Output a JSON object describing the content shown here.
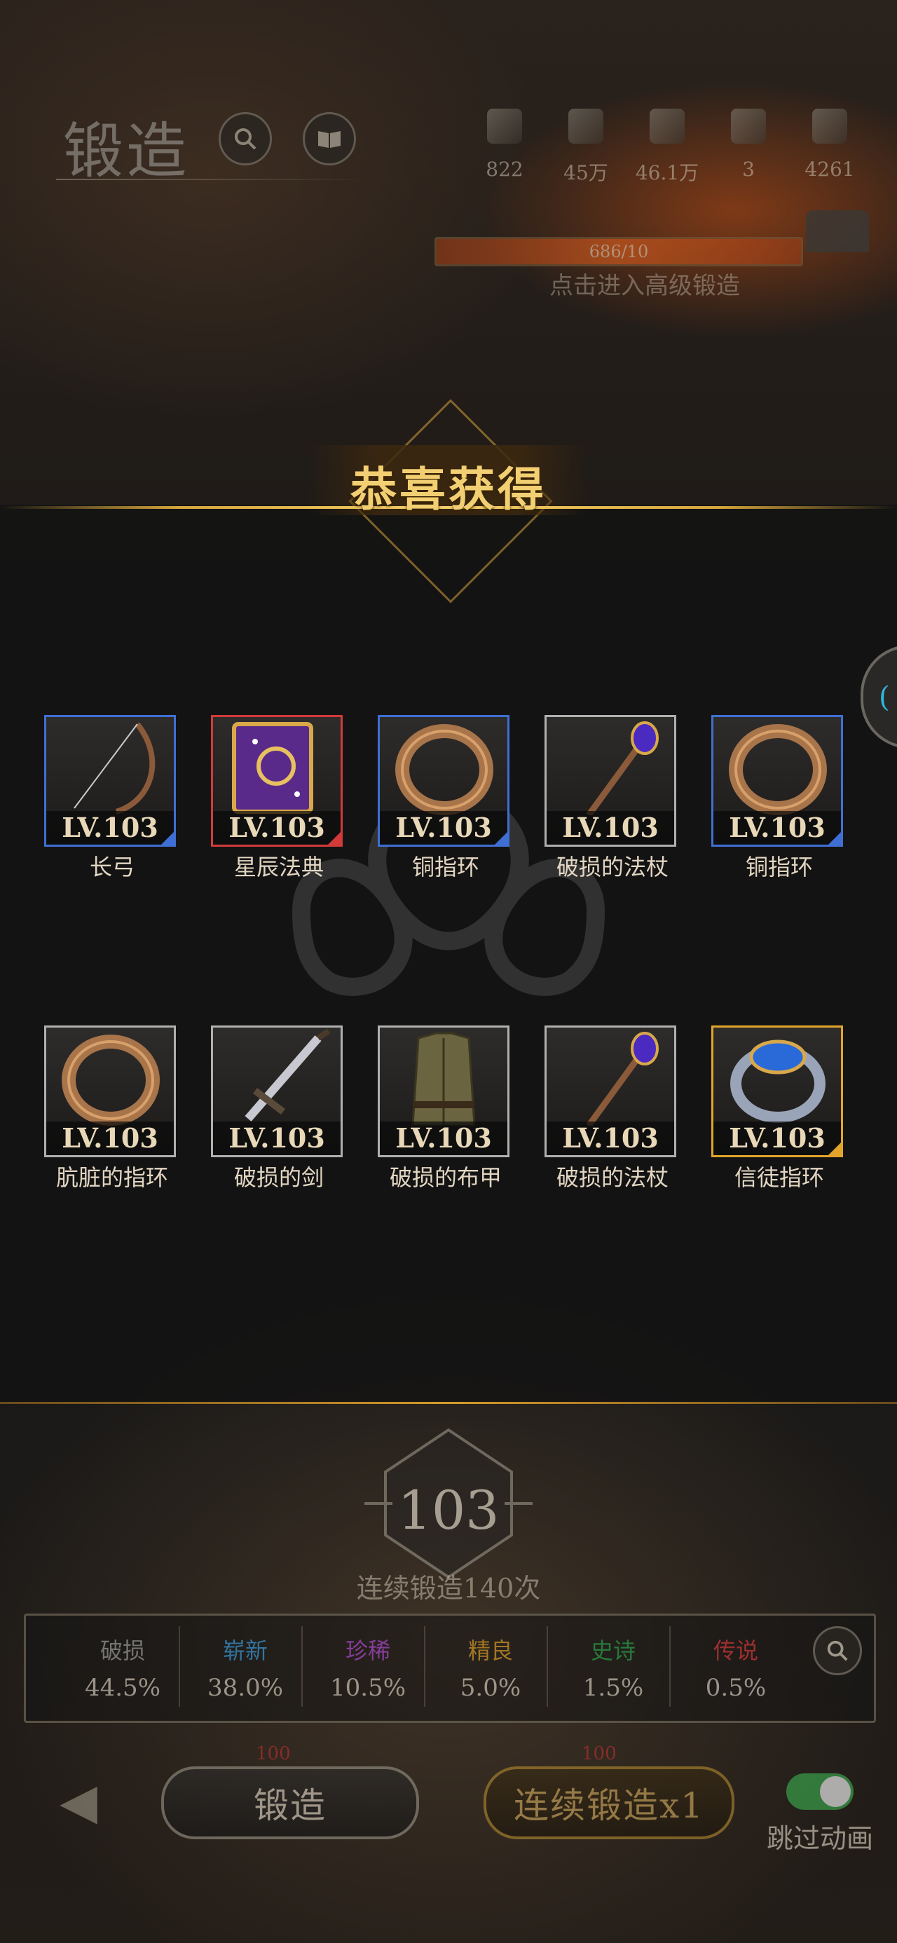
{
  "header": {
    "title": "锻造",
    "search_icon": "search-icon",
    "book_icon": "book-icon"
  },
  "resources": [
    {
      "icon": "ore-icon",
      "value": "822"
    },
    {
      "icon": "wood-icon",
      "value": "45万"
    },
    {
      "icon": "iron-icon",
      "value": "46.1万"
    },
    {
      "icon": "crystal-icon",
      "value": "3"
    },
    {
      "icon": "gold-icon",
      "value": "4261"
    }
  ],
  "forge": {
    "progress_text": "686/10",
    "hint": "点击进入高级锻造"
  },
  "banner": {
    "title": "恭喜获得"
  },
  "items": [
    {
      "level": "LV.103",
      "name": "长弓",
      "rarity": "blue",
      "art": "bow"
    },
    {
      "level": "LV.103",
      "name": "星辰法典",
      "rarity": "red",
      "art": "book"
    },
    {
      "level": "LV.103",
      "name": "铜指环",
      "rarity": "blue",
      "art": "ring"
    },
    {
      "level": "LV.103",
      "name": "破损的法杖",
      "rarity": "gray",
      "art": "staff"
    },
    {
      "level": "LV.103",
      "name": "铜指环",
      "rarity": "blue",
      "art": "ring"
    },
    {
      "level": "LV.103",
      "name": "肮脏的指环",
      "rarity": "gray",
      "art": "ring"
    },
    {
      "level": "LV.103",
      "name": "破损的剑",
      "rarity": "gray",
      "art": "sword"
    },
    {
      "level": "LV.103",
      "name": "破损的布甲",
      "rarity": "gray",
      "art": "armor"
    },
    {
      "level": "LV.103",
      "name": "破损的法杖",
      "rarity": "gray",
      "art": "staff"
    },
    {
      "level": "LV.103",
      "name": "信徒指环",
      "rarity": "gold",
      "art": "bluering"
    }
  ],
  "forge_level": "103",
  "continuous_text": "连续锻造140次",
  "rates": [
    {
      "name": "破损",
      "value": "44.5%",
      "color": "#9a9a9a"
    },
    {
      "name": "崭新",
      "value": "38.0%",
      "color": "#3a9ad8"
    },
    {
      "name": "珍稀",
      "value": "10.5%",
      "color": "#b04ad0"
    },
    {
      "name": "精良",
      "value": "5.0%",
      "color": "#d89a2a"
    },
    {
      "name": "史诗",
      "value": "1.5%",
      "color": "#2aa04a"
    },
    {
      "name": "传说",
      "value": "0.5%",
      "color": "#d03a3a"
    }
  ],
  "buttons": {
    "forge": "锻造",
    "forge_cost": "100",
    "continuous": "连续锻造x1",
    "continuous_cost": "100"
  },
  "toggle": {
    "label": "跳过动画",
    "on": true
  },
  "side_tab": {
    "glyph": "("
  }
}
